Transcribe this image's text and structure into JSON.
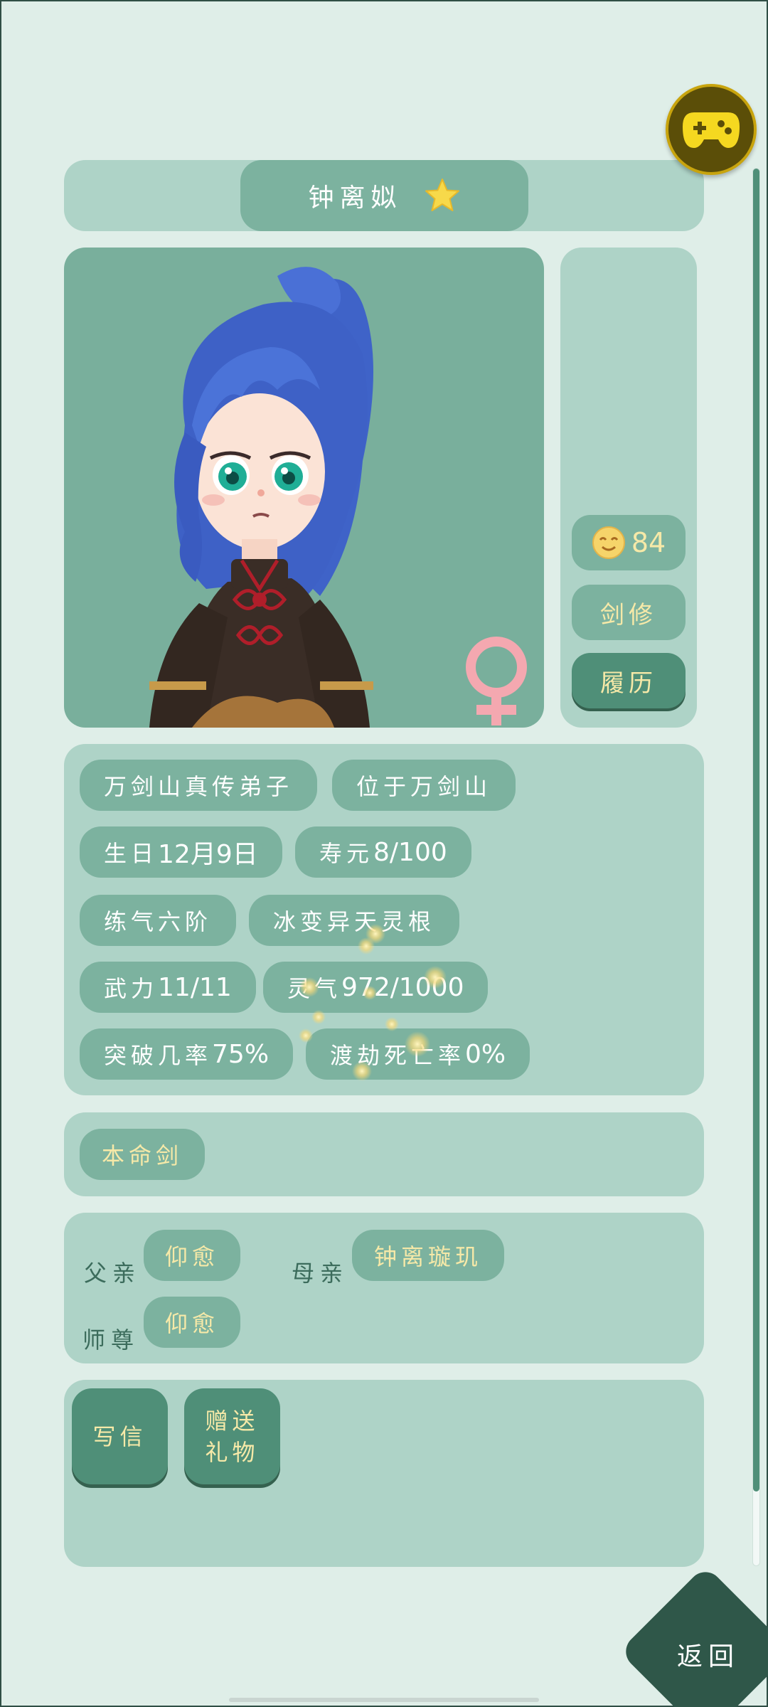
{
  "header": {
    "name": "钟离姒",
    "favorite_icon": "star-icon",
    "game_icon": "gamepad-icon"
  },
  "portrait": {
    "gender_symbol": "♀",
    "gender_color": "#f4a8b0"
  },
  "side_panel": {
    "mood_icon": "smile-face-icon",
    "mood_value": "84",
    "class_label": "剑修",
    "history_button": "履历"
  },
  "info": {
    "sect": "万剑山真传弟子",
    "location": "位于万剑山",
    "birthday_label": "生日",
    "birthday_value": "12月9日",
    "lifespan_label": "寿元",
    "lifespan_value": "8/100",
    "realm": "练气六阶",
    "spirit_root": "冰变异天灵根",
    "power_label": "武力",
    "power_value": "11/11",
    "spirit_label": "灵气",
    "spirit_value": "972/1000",
    "breakthrough_label": "突破几率",
    "breakthrough_value": "75%",
    "tribulation_label": "渡劫死亡率",
    "tribulation_value": "0%"
  },
  "sword": {
    "label": "本命剑"
  },
  "relations": {
    "father_label": "父亲",
    "father_name": "仰愈",
    "mother_label": "母亲",
    "mother_name": "钟离璇玑",
    "master_label": "师尊",
    "master_name": "仰愈"
  },
  "actions": {
    "write_letter": "写信",
    "gift_line1": "赠送",
    "gift_line2": "礼物"
  },
  "footer": {
    "return_label": "返回"
  },
  "colors": {
    "background": "#dfeee8",
    "panel": "#aed3c7",
    "chip": "#7cb29f",
    "dark_button": "#4f8f78",
    "gold_text": "#f6e9a8"
  }
}
